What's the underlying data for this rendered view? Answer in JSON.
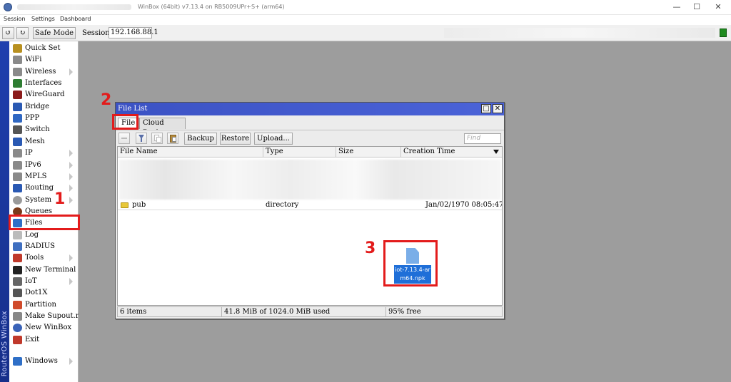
{
  "window": {
    "title": "WinBox (64bit) v7.13.4 on RB5009UPr+S+ (arm64)",
    "controls": [
      "—",
      "☐",
      "✕"
    ]
  },
  "menu": [
    "Session",
    "Settings",
    "Dashboard"
  ],
  "toolbar": {
    "undo": "↺",
    "redo": "↻",
    "safe_mode": "Safe Mode",
    "session_label": "Session:",
    "session_value": "192.168.88.1"
  },
  "brand": "RouterOS WinBox",
  "sidebar": [
    {
      "label": "Quick Set",
      "icon": "wand-icon",
      "arrow": false
    },
    {
      "label": "WiFi",
      "icon": "antenna-icon",
      "arrow": false
    },
    {
      "label": "Wireless",
      "icon": "antenna-icon",
      "arrow": true
    },
    {
      "label": "Interfaces",
      "icon": "interfaces-icon",
      "arrow": false
    },
    {
      "label": "WireGuard",
      "icon": "wireguard-icon",
      "arrow": false
    },
    {
      "label": "Bridge",
      "icon": "bridge-icon",
      "arrow": false
    },
    {
      "label": "PPP",
      "icon": "ppp-icon",
      "arrow": false
    },
    {
      "label": "Switch",
      "icon": "switch-icon",
      "arrow": false
    },
    {
      "label": "Mesh",
      "icon": "mesh-icon",
      "arrow": false
    },
    {
      "label": "IP",
      "icon": "ip-icon",
      "arrow": true
    },
    {
      "label": "IPv6",
      "icon": "ipv6-icon",
      "arrow": true
    },
    {
      "label": "MPLS",
      "icon": "mpls-icon",
      "arrow": true
    },
    {
      "label": "Routing",
      "icon": "routing-icon",
      "arrow": true
    },
    {
      "label": "System",
      "icon": "gear-icon",
      "arrow": true
    },
    {
      "label": "Queues",
      "icon": "queues-icon",
      "arrow": false
    },
    {
      "label": "Files",
      "icon": "folder-icon",
      "arrow": false
    },
    {
      "label": "Log",
      "icon": "log-icon",
      "arrow": false
    },
    {
      "label": "RADIUS",
      "icon": "radius-icon",
      "arrow": false
    },
    {
      "label": "Tools",
      "icon": "tools-icon",
      "arrow": true
    },
    {
      "label": "New Terminal",
      "icon": "terminal-icon",
      "arrow": false
    },
    {
      "label": "IoT",
      "icon": "iot-icon",
      "arrow": true
    },
    {
      "label": "Dot1X",
      "icon": "dot1x-icon",
      "arrow": false
    },
    {
      "label": "Partition",
      "icon": "partition-icon",
      "arrow": false
    },
    {
      "label": "Make Supout.rif",
      "icon": "supout-icon",
      "arrow": false
    },
    {
      "label": "New WinBox",
      "icon": "winbox-icon",
      "arrow": false
    },
    {
      "label": "Exit",
      "icon": "exit-icon",
      "arrow": false
    },
    {
      "label": "Windows",
      "icon": "windows-icon",
      "arrow": true
    }
  ],
  "file_list": {
    "title": "File List",
    "tabs": [
      "File",
      "Cloud Backup"
    ],
    "buttons": [
      "Backup",
      "Restore",
      "Upload..."
    ],
    "find_placeholder": "Find",
    "columns": [
      "File Name",
      "Type",
      "Size",
      "Creation Time"
    ],
    "rows": [
      {
        "name": "pub",
        "type": "directory",
        "size": "",
        "created": "Jan/02/1970 08:05:47"
      }
    ],
    "dropped_file": "iot-7.13.4-arm64.npk",
    "status": {
      "items": "6 items",
      "used": "41.8 MiB of 1024.0 MiB used",
      "free": "95% free"
    }
  },
  "annotations": [
    "1",
    "2",
    "3"
  ],
  "colors": {
    "annotation": "#e31b1b",
    "title_bar": "#3b52c4",
    "brand_strip": "#1f3fae"
  }
}
